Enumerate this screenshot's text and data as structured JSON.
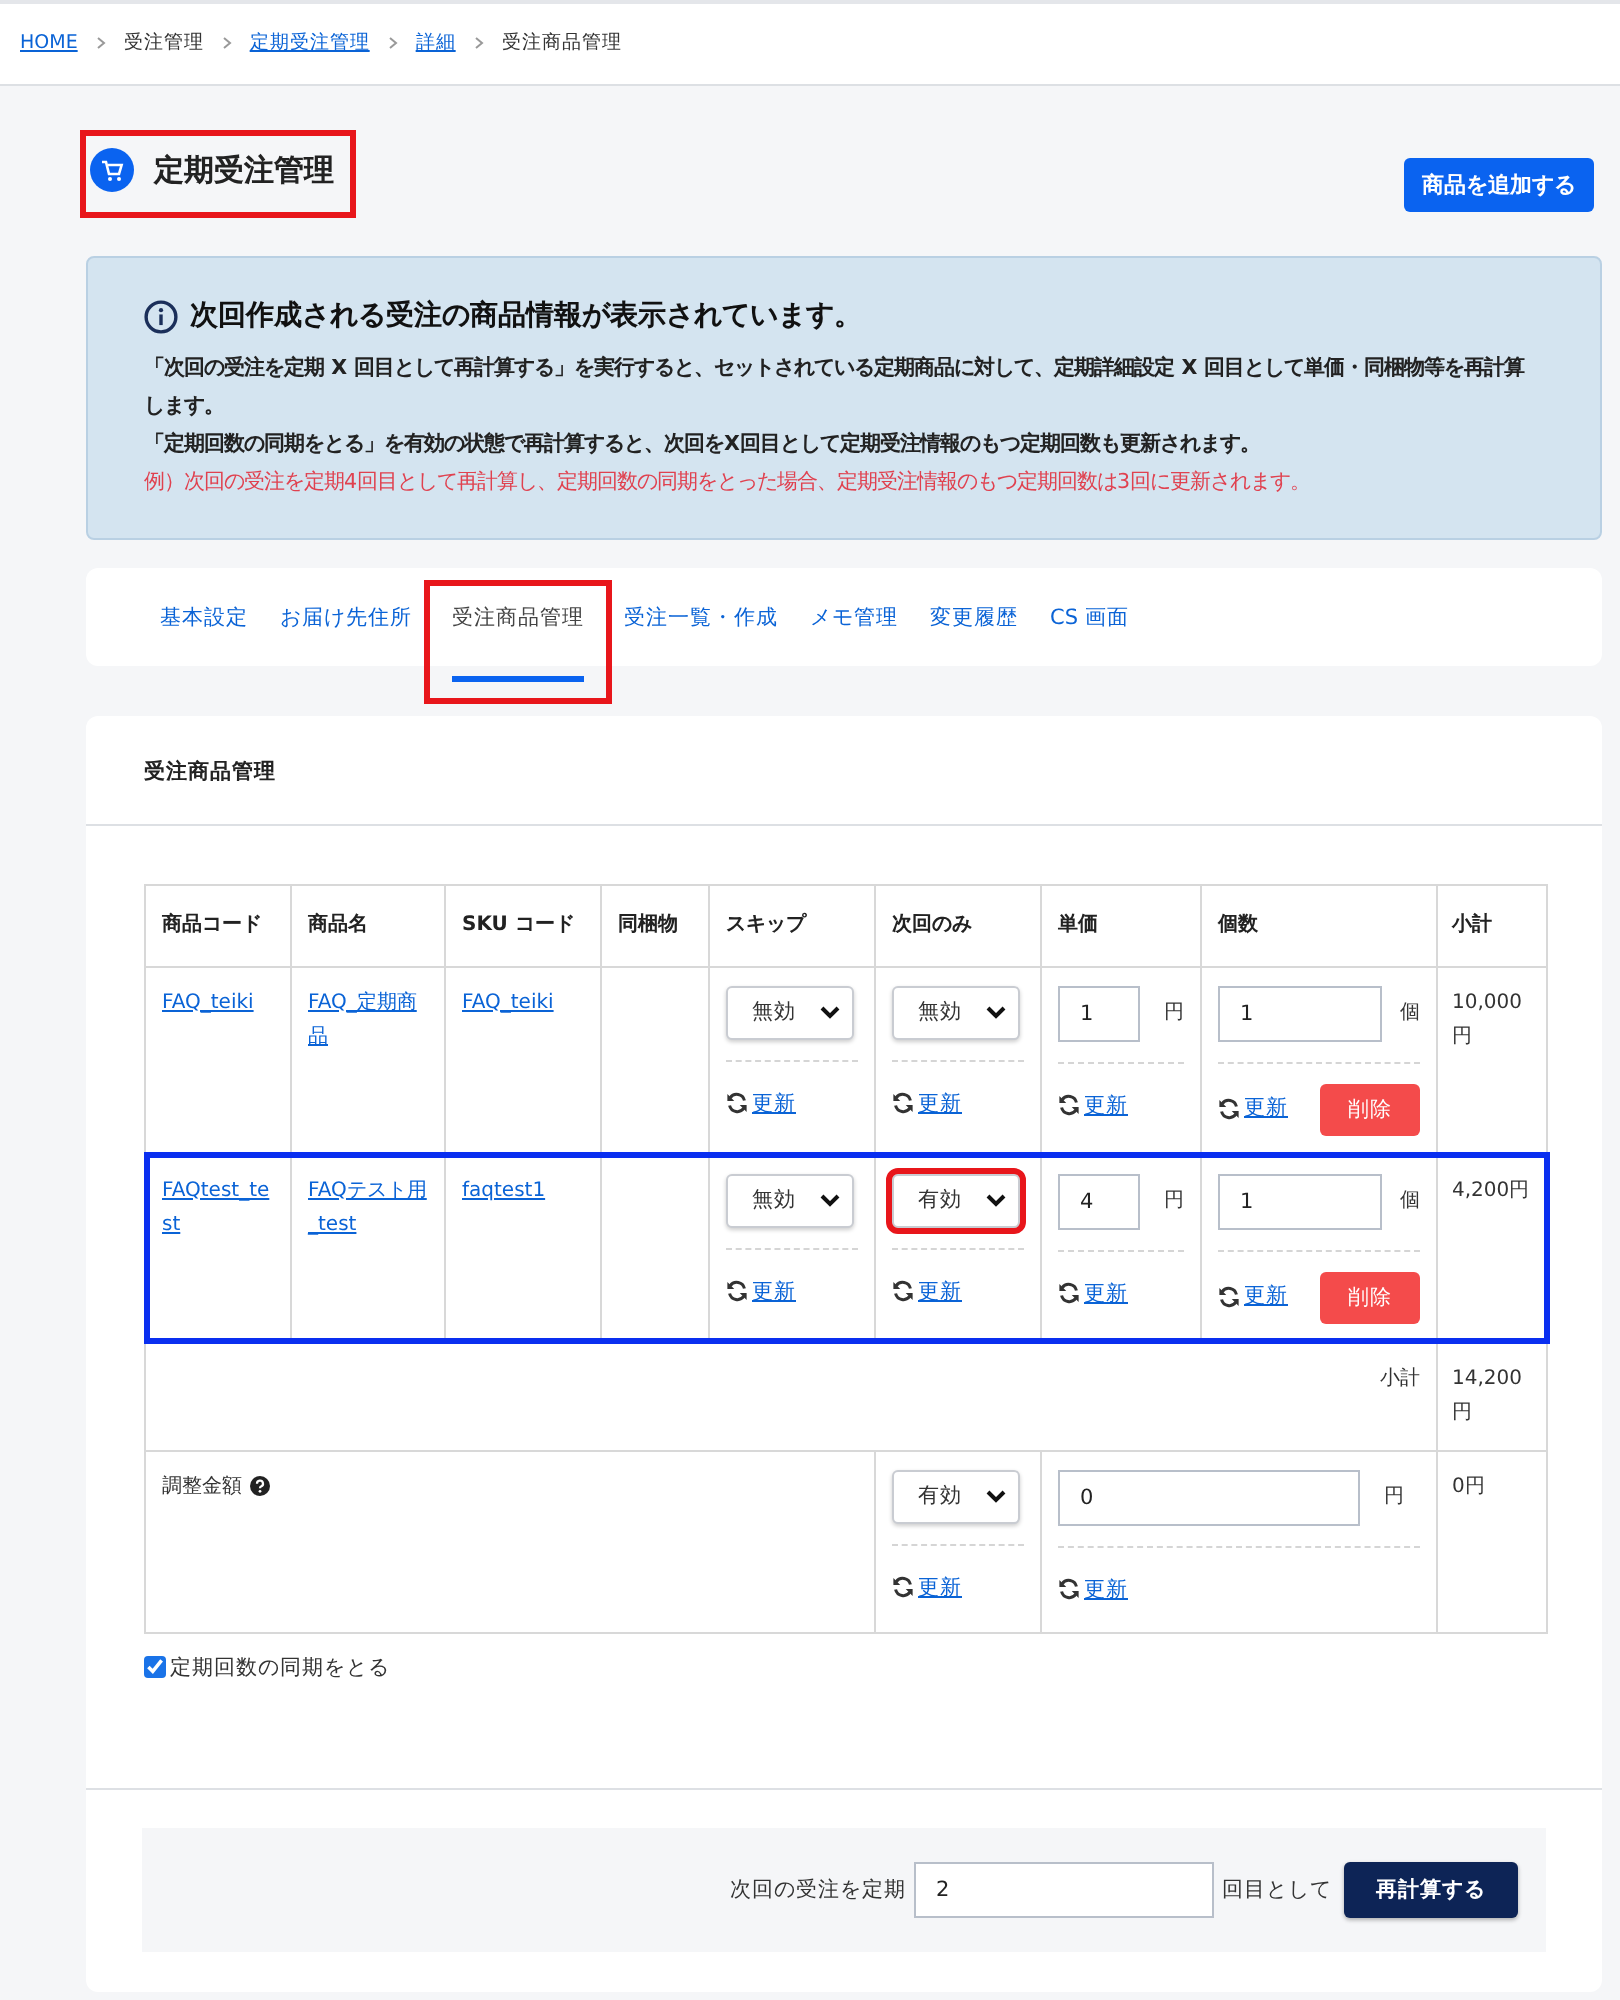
{
  "breadcrumb": [
    {
      "label": "HOME",
      "link": true
    },
    {
      "label": "受注管理",
      "link": false
    },
    {
      "label": "定期受注管理",
      "link": true
    },
    {
      "label": "詳細",
      "link": true
    },
    {
      "label": "受注商品管理",
      "link": false
    }
  ],
  "page_title": {
    "text": "定期受注管理",
    "highlighted": true
  },
  "add_button": "商品を追加する",
  "notice": {
    "title": "次回作成される受注の商品情報が表示されています。",
    "lines": [
      {
        "kind": "normal",
        "text": "「次回の受注を定期 X 回目として再計算する」を実行すると、セットされている定期商品に対して、定期詳細設定 X 回目として単価・同梱物等を再計算します。"
      },
      {
        "kind": "normal",
        "text": "「定期回数の同期をとる」を有効の状態で再計算すると、次回をX回目として定期受注情報のもつ定期回数も更新されます。"
      },
      {
        "kind": "example",
        "text": "例）次回の受注を定期4回目として再計算し、定期回数の同期をとった場合、定期受注情報のもつ定期回数は3回に更新されます。"
      }
    ]
  },
  "tabs": [
    {
      "label": "基本設定",
      "selected": false,
      "highlighted": false
    },
    {
      "label": "お届け先住所",
      "selected": false,
      "highlighted": false
    },
    {
      "label": "受注商品管理",
      "selected": true,
      "highlighted": true
    },
    {
      "label": "受注一覧・作成",
      "selected": false,
      "highlighted": false
    },
    {
      "label": "メモ管理",
      "selected": false,
      "highlighted": false
    },
    {
      "label": "変更履歴",
      "selected": false,
      "highlighted": false
    },
    {
      "label": "CS 画面",
      "selected": false,
      "highlighted": false
    }
  ],
  "section_title": "受注商品管理",
  "table": {
    "columns": [
      "商品コード",
      "商品名",
      "SKU コード",
      "同梱物",
      "スキップ",
      "次回のみ",
      "単価",
      "個数",
      "小計"
    ],
    "rows": [
      {
        "code": "FAQ_teiki",
        "name": "FAQ_定期商品",
        "sku": "FAQ_teiki",
        "highlighted": false,
        "skip": {
          "value": "無効",
          "update": "更新"
        },
        "next_only": {
          "value": "無効",
          "update": "更新",
          "highlighted": false
        },
        "unit_price": {
          "value": "1",
          "unit": "円",
          "update": "更新"
        },
        "quantity": {
          "value": "1",
          "unit": "個",
          "update": "更新",
          "delete": "削除"
        },
        "subtotal": "10,000円"
      },
      {
        "code": "FAQtest_test",
        "name": "FAQテスト用_test",
        "sku": "faqtest1",
        "highlighted": true,
        "skip": {
          "value": "無効",
          "update": "更新"
        },
        "next_only": {
          "value": "有効",
          "update": "更新",
          "highlighted": true
        },
        "unit_price": {
          "value": "4",
          "unit": "円",
          "update": "更新"
        },
        "quantity": {
          "value": "1",
          "unit": "個",
          "update": "更新",
          "delete": "削除"
        },
        "subtotal": "4,200円"
      }
    ],
    "subtotal": {
      "label": "小計",
      "value": "14,200円"
    },
    "adjustment": {
      "label": "調整金額",
      "select": "有効",
      "select_update": "更新",
      "amount": "0",
      "unit": "円",
      "amount_update": "更新",
      "total": "0円"
    }
  },
  "sync_checkbox": {
    "label": "定期回数の同期をとる",
    "checked": true
  },
  "recalc": {
    "prefix": "次回の受注を定期",
    "value": "2",
    "suffix": "回目として",
    "button": "再計算する"
  }
}
